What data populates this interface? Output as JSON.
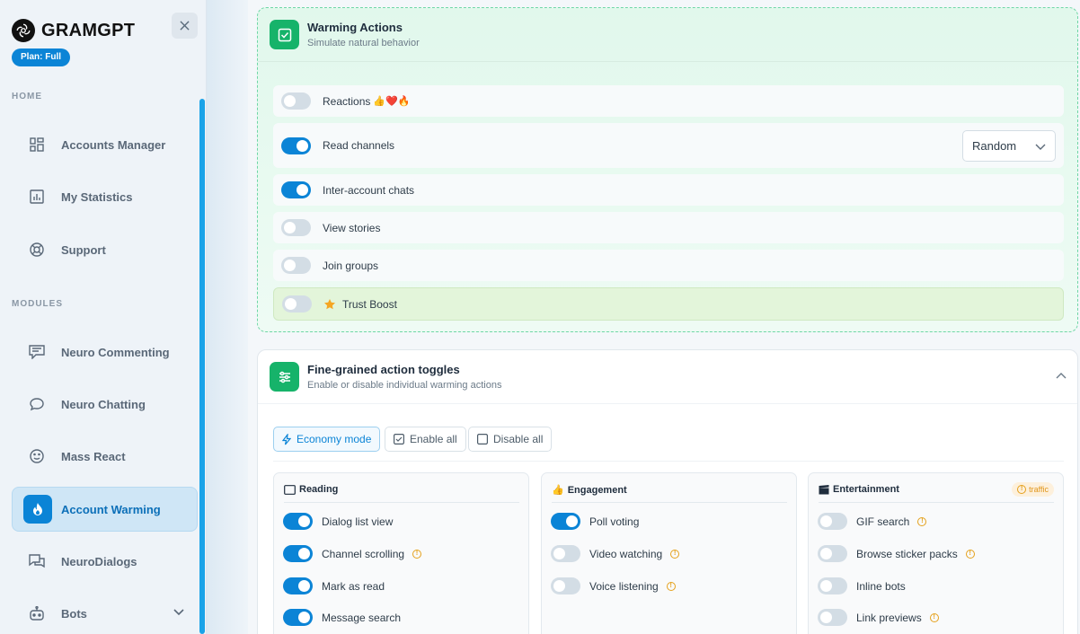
{
  "brand": {
    "name": "GRAMGPT",
    "plan": "Plan: Full"
  },
  "sidebar": {
    "home_label": "HOME",
    "modules_label": "MODULES",
    "home_items": [
      {
        "label": "Accounts Manager",
        "icon": "grid-icon"
      },
      {
        "label": "My Statistics",
        "icon": "chart-icon"
      },
      {
        "label": "Support",
        "icon": "lifebuoy-icon"
      }
    ],
    "module_items": [
      {
        "label": "Neuro Commenting",
        "icon": "comment-icon"
      },
      {
        "label": "Neuro Chatting",
        "icon": "chat-bubble-icon"
      },
      {
        "label": "Mass React",
        "icon": "smile-icon"
      },
      {
        "label": "Account Warming",
        "icon": "flame-icon",
        "active": true
      },
      {
        "label": "NeuroDialogs",
        "icon": "dialogs-icon"
      },
      {
        "label": "Bots",
        "icon": "bot-icon"
      }
    ]
  },
  "warming": {
    "title": "Warming Actions",
    "subtitle": "Simulate natural behavior",
    "rows": [
      {
        "label": "Reactions",
        "suffix": "👍❤️🔥",
        "on": false
      },
      {
        "label": "Read channels",
        "on": true,
        "select": "Random"
      },
      {
        "label": "Inter-account chats",
        "on": true
      },
      {
        "label": "View stories",
        "on": false
      },
      {
        "label": "Join groups",
        "on": false
      },
      {
        "label": "Trust Boost",
        "on": false,
        "highlight": true
      }
    ]
  },
  "fine": {
    "title": "Fine-grained action toggles",
    "subtitle": "Enable or disable individual warming actions",
    "buttons": {
      "economy": "Economy mode",
      "enable": "Enable all",
      "disable": "Disable all"
    },
    "columns": [
      {
        "title": "Reading",
        "icon": "book-icon",
        "items": [
          {
            "label": "Dialog list view",
            "on": true,
            "info": false
          },
          {
            "label": "Channel scrolling",
            "on": true,
            "info": true
          },
          {
            "label": "Mark as read",
            "on": true,
            "info": false
          },
          {
            "label": "Message search",
            "on": true,
            "info": false
          }
        ]
      },
      {
        "title": "Engagement",
        "icon": "thumbs-up-icon",
        "items": [
          {
            "label": "Poll voting",
            "on": true,
            "info": false
          },
          {
            "label": "Video watching",
            "on": false,
            "info": true
          },
          {
            "label": "Voice listening",
            "on": false,
            "info": true
          }
        ]
      },
      {
        "title": "Entertainment",
        "icon": "clapper-icon",
        "badge": "traffic",
        "items": [
          {
            "label": "GIF search",
            "on": false,
            "info": true
          },
          {
            "label": "Browse sticker packs",
            "on": false,
            "info": true
          },
          {
            "label": "Inline bots",
            "on": false,
            "info": false
          },
          {
            "label": "Link previews",
            "on": false,
            "info": true
          }
        ]
      }
    ]
  }
}
